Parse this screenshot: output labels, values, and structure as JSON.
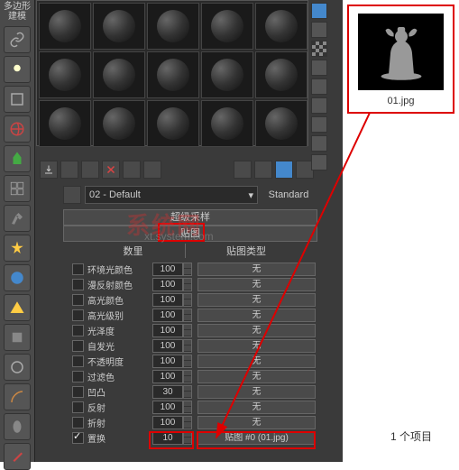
{
  "sidebar": {
    "mode_label": "多边形建模"
  },
  "material": {
    "selected": "02 - Default",
    "type": "Standard"
  },
  "rollouts": {
    "supersample": "超级采样",
    "maps": "贴图"
  },
  "subheader": {
    "amount": "数里",
    "map_type": "贴图类型"
  },
  "maps": [
    {
      "label": "环境光颜色",
      "amount": "100",
      "slot": "无",
      "checked": false
    },
    {
      "label": "漫反射颜色",
      "amount": "100",
      "slot": "无",
      "checked": false
    },
    {
      "label": "高光颜色",
      "amount": "100",
      "slot": "无",
      "checked": false
    },
    {
      "label": "高光级别",
      "amount": "100",
      "slot": "无",
      "checked": false
    },
    {
      "label": "光泽度",
      "amount": "100",
      "slot": "无",
      "checked": false
    },
    {
      "label": "自发光",
      "amount": "100",
      "slot": "无",
      "checked": false
    },
    {
      "label": "不透明度",
      "amount": "100",
      "slot": "无",
      "checked": false
    },
    {
      "label": "过滤色",
      "amount": "100",
      "slot": "无",
      "checked": false
    },
    {
      "label": "凹凸",
      "amount": "30",
      "slot": "无",
      "checked": false
    },
    {
      "label": "反射",
      "amount": "100",
      "slot": "无",
      "checked": false
    },
    {
      "label": "折射",
      "amount": "100",
      "slot": "无",
      "checked": false
    },
    {
      "label": "置换",
      "amount": "10",
      "slot": "贴图 #0 (01.jpg)",
      "checked": true
    }
  ],
  "thumbnail": {
    "filename": "01.jpg"
  },
  "status": {
    "filecount": "1 个项目"
  },
  "watermark": {
    "line1": "系统网",
    "line2": "xt.system.com"
  }
}
